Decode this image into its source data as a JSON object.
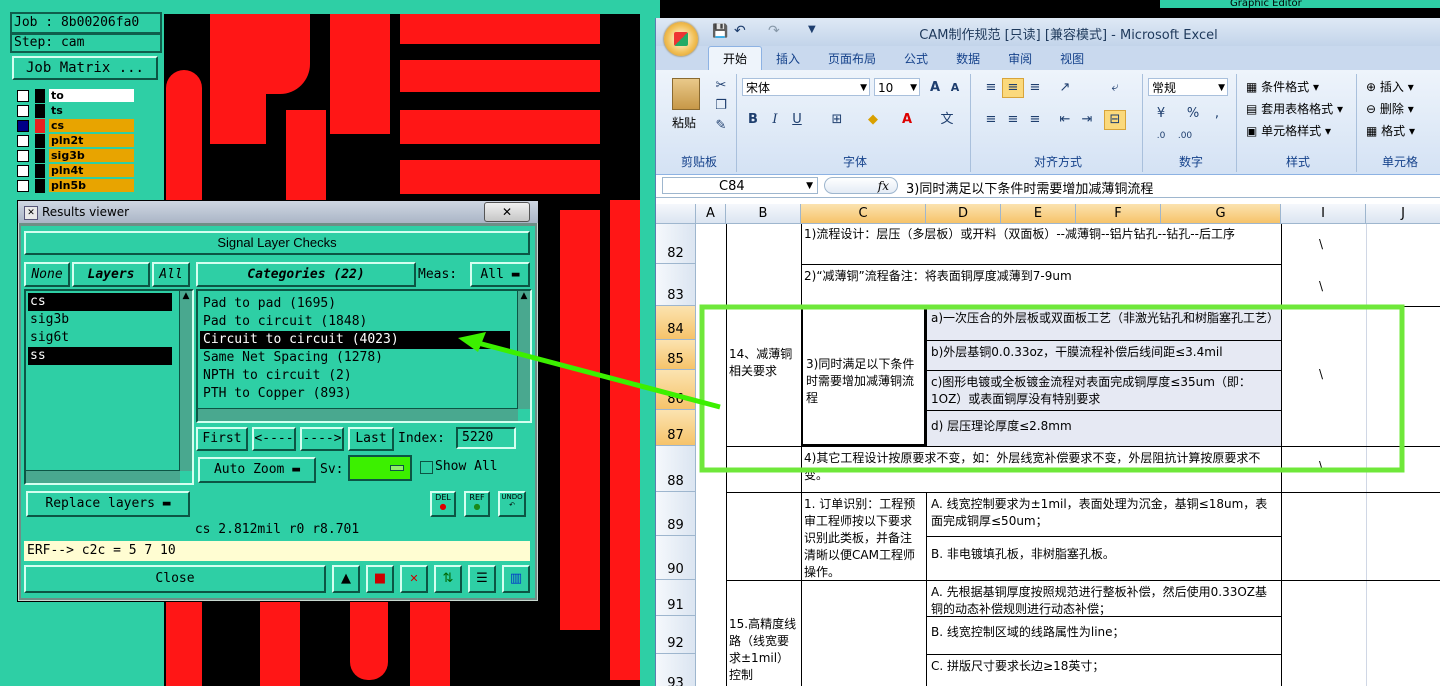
{
  "cam": {
    "job_label": "Job : 8b00206fa0",
    "step_label": "Step: cam",
    "job_matrix": "Job Matrix ...",
    "layers": [
      {
        "name": "to",
        "color": "#ffffff"
      },
      {
        "name": "ts",
        "color": "#2ecfa5"
      },
      {
        "name": "cs",
        "color": "#e8a400"
      },
      {
        "name": "pln2t",
        "color": "#e8a400"
      },
      {
        "name": "sig3b",
        "color": "#e8a400"
      },
      {
        "name": "pln4t",
        "color": "#e8a400"
      },
      {
        "name": "pln5b",
        "color": "#e8a400"
      }
    ],
    "top_right_title": "Graphic Editor"
  },
  "results_viewer": {
    "window_title": "Results viewer",
    "header": "Signal Layer Checks",
    "none_btn": "None",
    "layers_btn": "Layers",
    "all_btn": "All",
    "layer_list": [
      "cs",
      "sig3b",
      "sig6t",
      "ss"
    ],
    "selected_layers": [
      "cs",
      "ss"
    ],
    "categories_btn": "Categories (22)",
    "meas_label": "Meas:",
    "meas_value": "All",
    "categories": [
      "Pad to pad (1695)",
      "Pad to circuit (1848)",
      "Circuit to circuit (4023)",
      "Same Net Spacing (1278)",
      "NPTH to circuit (2)",
      "PTH to Copper (893)"
    ],
    "selected_category": "Circuit to circuit (4023)",
    "first_btn": "First",
    "prev_btn": "<----",
    "next_btn": "---->",
    "last_btn": "Last",
    "index_label": "Index:",
    "index_value": "5220",
    "auto_zoom": "Auto Zoom",
    "sv_label": "Sv:",
    "show_all": "Show All",
    "replace_layers": "Replace layers",
    "del_btn": "DEL",
    "ref_btn": "REF",
    "undo_btn": "UNDO",
    "status_line": "cs 2.812mil  r0  r8.701",
    "erf_line": "ERF--> c2c = 5 7 10",
    "close_btn": "Close",
    "accent_green": "#3cf000"
  },
  "excel": {
    "title": "CAM制作规范 [只读] [兼容模式] - Microsoft Excel",
    "tabs": [
      "开始",
      "插入",
      "页面布局",
      "公式",
      "数据",
      "审阅",
      "视图"
    ],
    "active_tab": "开始",
    "ribbon": {
      "paste": "粘贴",
      "clipboard_group": "剪贴板",
      "font_name": "宋体",
      "font_size": "10",
      "font_group": "字体",
      "align_group": "对齐方式",
      "number_format": "常规",
      "number_group": "数字",
      "cond_format": "条件格式",
      "table_format": "套用表格格式",
      "cell_style": "单元格样式",
      "styles_group": "样式",
      "insert": "插入",
      "delete": "删除",
      "format": "格式",
      "cells_group": "单元格"
    },
    "name_box": "C84",
    "fx": "fx",
    "formula": "3)同时满足以下条件时需要增加减薄铜流程",
    "columns": [
      "A",
      "B",
      "C",
      "D",
      "E",
      "F",
      "G",
      "I",
      "J"
    ],
    "rows": [
      "82",
      "83",
      "84",
      "85",
      "86",
      "87",
      "88",
      "89",
      "90",
      "91",
      "92",
      "93"
    ],
    "cells": {
      "r82": "1)流程设计：层压（多层板）或开料（双面板）--减薄铜--铝片钻孔--钻孔--后工序",
      "r83": "2)“减薄铜”流程备注：将表面铜厚度减薄到7-9um",
      "b84": "14、减薄铜相关要求",
      "c84": "3)同时满足以下条件时需要增加减薄铜流程",
      "d84": "a)一次压合的外层板或双面板工艺（非激光钻孔和树脂塞孔工艺）",
      "d85": "b)外层基铜0.0.33oz，干膜流程补偿后线间距≤3.4mil",
      "d86": "c)图形电镀或全板镀金流程对表面完成铜厚度≤35um（即：1OZ）或表面铜厚没有特别要求",
      "d87": "d) 层压理论厚度≤2.8mm",
      "r88": "4)其它工程设计按原要求不变，如：外层线宽补偿要求不变，外层阻抗计算按原要求不变。",
      "c89": "1. 订单识别：工程预审工程师按以下要求识别此类板，并备注清晰以便CAM工程师操作。",
      "d89": "A. 线宽控制要求为±1mil，表面处理为沉金，基铜≤18um，表面完成铜厚≤50um；",
      "d90": "B. 非电镀填孔板，非树脂塞孔板。",
      "b91": "15.高精度线路（线宽要求±1mil）控制",
      "d91": "A. 先根据基铜厚度按照规范进行整板补偿，然后使用0.33OZ基铜的动态补偿规则进行动态补偿；",
      "d92": "B. 线宽控制区域的线路属性为line；",
      "d93": "C. 拼版尺寸要求长边≥18英寸；",
      "backslash": "\\"
    }
  }
}
